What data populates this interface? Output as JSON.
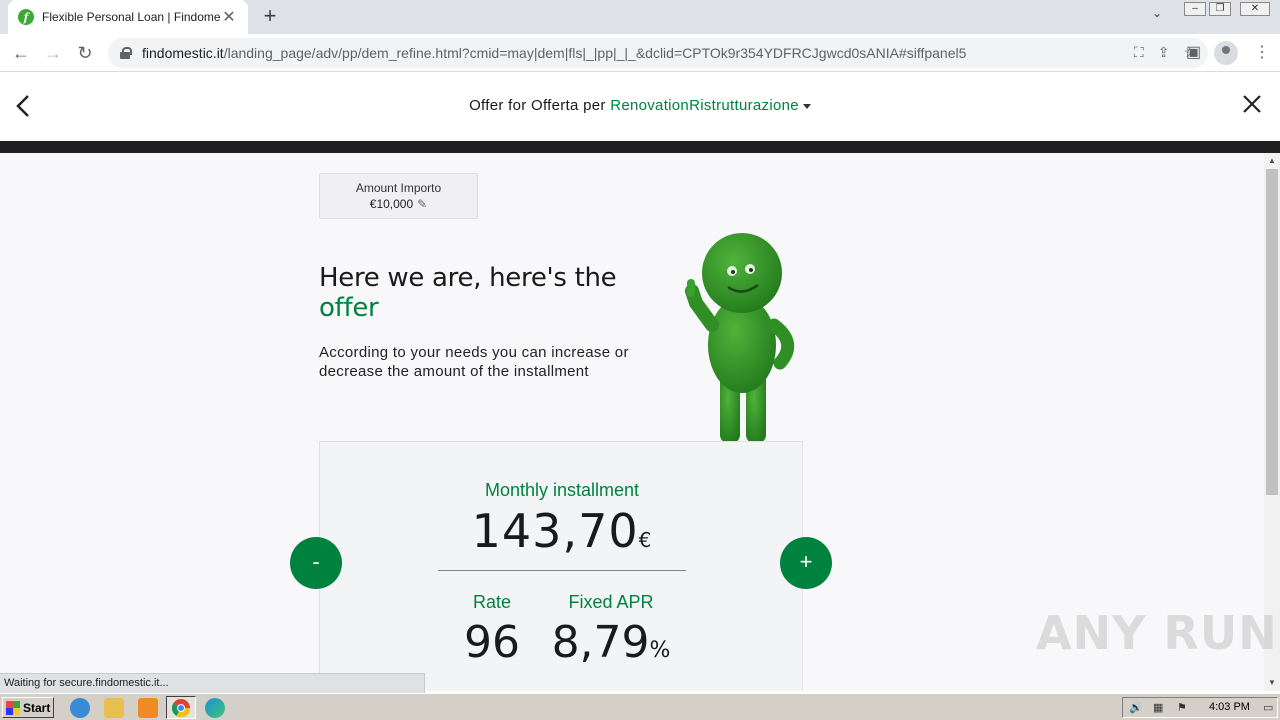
{
  "browser": {
    "tab_title": "Flexible Personal Loan | Findomestic",
    "tab_favicon_letter": "f",
    "url_domain": "findomestic.it",
    "url_path": "/landing_page/adv/pp/dem_refine.html?cmid=may|dem|fls|_|pp|_|_&dclid=CPTOk9r354YDFRCJgwcd0sANIA#siffpanel5",
    "status_text": "Waiting for secure.findomestic.it..."
  },
  "header": {
    "title_prefix": "Offer for Offerta per ",
    "title_highlight": "RenovationRistrutturazione"
  },
  "amount": {
    "label": "Amount Importo",
    "value": "€10,000"
  },
  "hero": {
    "headline": "Here we are, here's the",
    "headline_green": "offer",
    "subtext": "According to your needs you can increase or decrease the amount of the installment"
  },
  "offer": {
    "monthly_label": "Monthly installment",
    "monthly_value": "143,70",
    "monthly_currency": "€",
    "rate_label": "Rate",
    "rate_value": "96",
    "apr_label": "Fixed APR",
    "apr_value": "8,79",
    "apr_unit": "%",
    "minus_label": "-",
    "plus_label": "+"
  },
  "watermark": "ANY RUN",
  "taskbar": {
    "start_label": "Start",
    "clock": "4:03 PM"
  },
  "colors": {
    "brand_green": "#00823f",
    "dark_band": "#1d1f20"
  }
}
